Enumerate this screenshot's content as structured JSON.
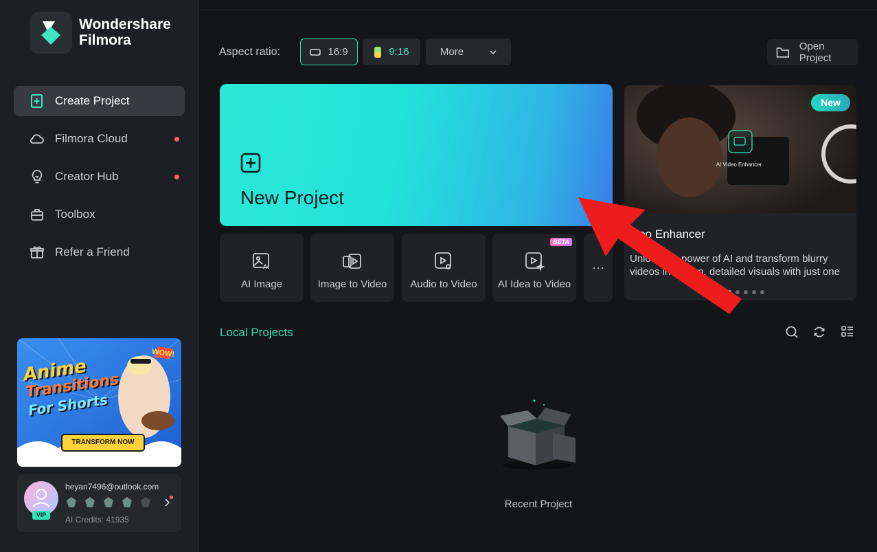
{
  "app": {
    "brand_line1": "Wondershare",
    "brand_line2": "Filmora"
  },
  "sidebar": {
    "items": [
      {
        "label": "Create Project",
        "icon": "plus-square-icon",
        "active": true,
        "dot": false
      },
      {
        "label": "Filmora Cloud",
        "icon": "cloud-icon",
        "active": false,
        "dot": true
      },
      {
        "label": "Creator Hub",
        "icon": "lightbulb-icon",
        "active": false,
        "dot": true
      },
      {
        "label": "Toolbox",
        "icon": "toolbox-icon",
        "active": false,
        "dot": false
      },
      {
        "label": "Refer a Friend",
        "icon": "gift-icon",
        "active": false,
        "dot": false
      }
    ],
    "promo": {
      "line1": "Anime",
      "line2": "Transitions",
      "line3": "For Shorts",
      "cta": "TRANSFORM NOW",
      "sticker": "WOW!"
    },
    "user": {
      "email": "heyan7496@outlook.com",
      "vip": "VIP",
      "credits": "AI Credits: 41935"
    }
  },
  "toolbar": {
    "aspect_label": "Aspect ratio:",
    "ratio_169": "16:9",
    "ratio_916": "9:16",
    "more": "More",
    "open_project": "Open Project"
  },
  "new_project": {
    "title": "New Project"
  },
  "tools": [
    {
      "label": "AI Image",
      "icon": "ai-image-icon"
    },
    {
      "label": "Image to Video",
      "icon": "image-to-video-icon"
    },
    {
      "label": "Audio to Video",
      "icon": "audio-to-video-icon"
    },
    {
      "label": "AI Idea to Video",
      "icon": "ai-idea-to-video-icon",
      "badge": "BETA"
    }
  ],
  "more_tools": "···",
  "feature": {
    "badge": "New",
    "overlay_label": "AI Video Enhancer",
    "title": "ideo Enhancer",
    "description": "Unlock the power of AI and transform blurry videos into crisp, detailed visuals with just one"
  },
  "local_projects": {
    "title": "Local Projects",
    "empty_label": "Recent Project"
  },
  "colors": {
    "accent": "#32d8b1",
    "background": "#131518",
    "sidebar": "#1c1f23",
    "annotation_arrow": "#ee1c1c"
  }
}
